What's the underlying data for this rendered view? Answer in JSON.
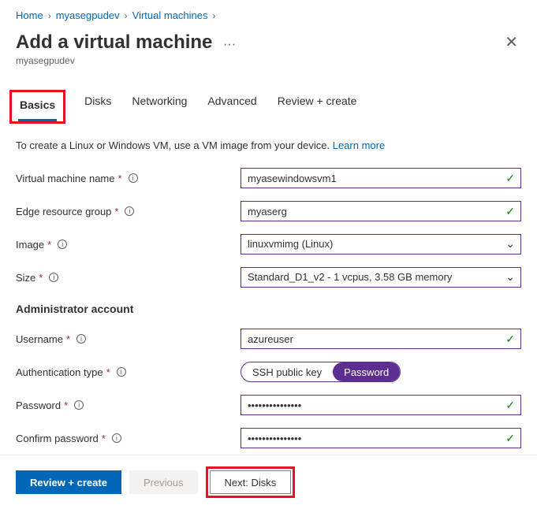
{
  "breadcrumb": {
    "home": "Home",
    "resource": "myasegpudev",
    "section": "Virtual machines"
  },
  "header": {
    "title": "Add a virtual machine",
    "subtitle": "myasegpudev"
  },
  "tabs": {
    "basics": "Basics",
    "disks": "Disks",
    "networking": "Networking",
    "advanced": "Advanced",
    "review": "Review + create"
  },
  "description": {
    "text": "To create a Linux or Windows VM, use a VM image from your device. ",
    "link": "Learn more"
  },
  "form": {
    "vm_name_label": "Virtual machine name",
    "vm_name_value": "myasewindowsvm1",
    "erg_label": "Edge resource group",
    "erg_value": "myaserg",
    "image_label": "Image",
    "image_value": "linuxvmimg (Linux)",
    "size_label": "Size",
    "size_value": "Standard_D1_v2 - 1 vcpus, 3.58 GB memory",
    "admin_section": "Administrator account",
    "username_label": "Username",
    "username_value": "azureuser",
    "auth_label": "Authentication type",
    "auth_ssh": "SSH public key",
    "auth_password": "Password",
    "password_label": "Password",
    "password_value": "•••••••••••••••",
    "confirm_label": "Confirm password",
    "confirm_value": "•••••••••••••••"
  },
  "footer": {
    "review": "Review + create",
    "previous": "Previous",
    "next": "Next: Disks"
  }
}
